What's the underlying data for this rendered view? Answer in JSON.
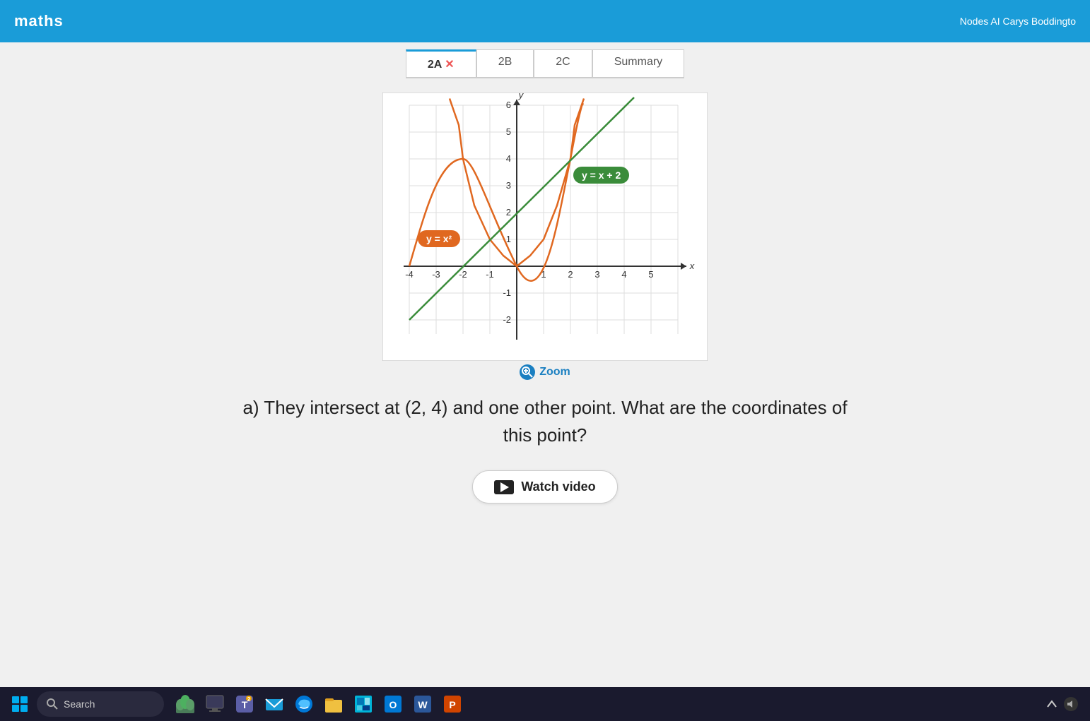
{
  "topbar": {
    "logo": "maths",
    "right_text": "Nodes AI   Carys Boddingto"
  },
  "tabs": [
    {
      "id": "2a",
      "label": "2A",
      "suffix": " ✕",
      "active": true
    },
    {
      "id": "2b",
      "label": "2B",
      "active": false
    },
    {
      "id": "2c",
      "label": "2C",
      "active": false
    },
    {
      "id": "summary",
      "label": "Summary",
      "active": false
    }
  ],
  "graph": {
    "label_parabola": "y = x²",
    "label_line": "y = x + 2",
    "x_axis_label": "x",
    "y_axis_label": "y"
  },
  "zoom_button": {
    "label": "Zoom"
  },
  "question": {
    "text": "a) They intersect at (2, 4) and one other point. What are the coordinates of this point?"
  },
  "watch_video": {
    "label": "Watch video"
  },
  "taskbar": {
    "search_placeholder": "Search",
    "icons": [
      "start",
      "search",
      "grass",
      "taskbar-blank",
      "teams",
      "mail",
      "edge",
      "files",
      "windows-store",
      "outlook",
      "word",
      "powerpoint"
    ]
  }
}
